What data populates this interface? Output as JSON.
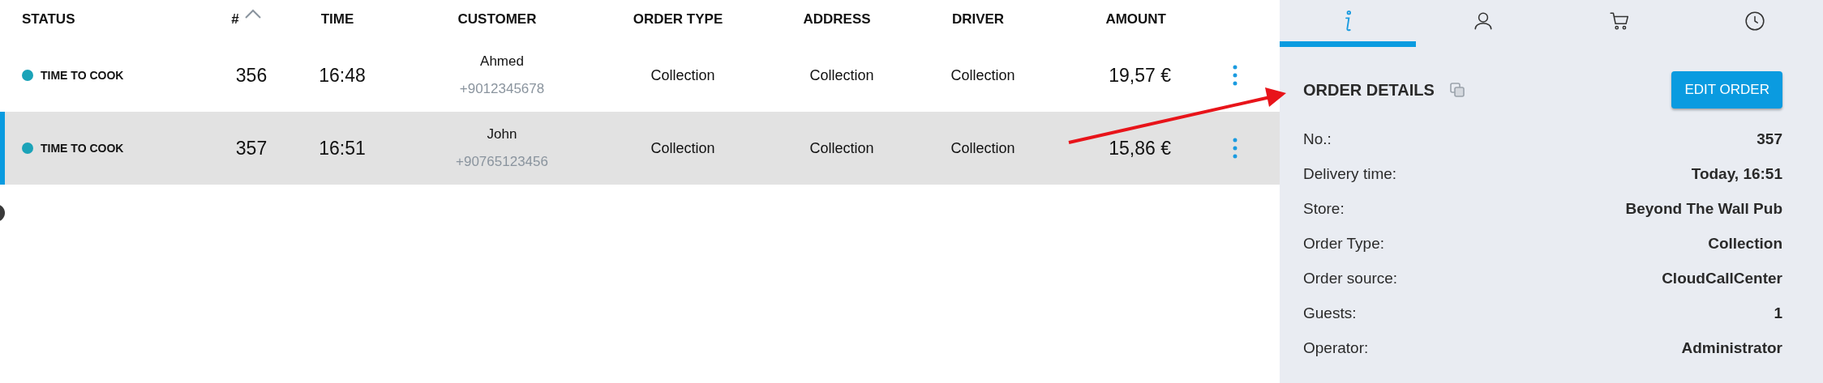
{
  "table": {
    "columns": [
      {
        "label": "STATUS",
        "sorted": false
      },
      {
        "label": "#",
        "sorted": true
      },
      {
        "label": "TIME",
        "sorted": false
      },
      {
        "label": "CUSTOMER",
        "sorted": false
      },
      {
        "label": "ORDER TYPE",
        "sorted": false
      },
      {
        "label": "ADDRESS",
        "sorted": false
      },
      {
        "label": "DRIVER",
        "sorted": false
      },
      {
        "label": "AMOUNT",
        "sorted": false
      }
    ],
    "rows": [
      {
        "status": "TIME TO COOK",
        "color": "#1ba3b8",
        "number": "356",
        "time": "16:48",
        "customer": "Ahmed",
        "phone": "+9012345678",
        "order_type": "Collection",
        "address": "Collection",
        "driver": "Collection",
        "amount": "19,57 €",
        "selected": false
      },
      {
        "status": "TIME TO COOK",
        "color": "#1ba3b8",
        "number": "357",
        "time": "16:51",
        "customer": "John",
        "phone": "+90765123456",
        "order_type": "Collection",
        "address": "Collection",
        "driver": "Collection",
        "amount": "15,86 €",
        "selected": true
      }
    ]
  },
  "panel": {
    "tabs": [
      {
        "kind": "info",
        "selected": true
      },
      {
        "kind": "person",
        "selected": false
      },
      {
        "kind": "cart",
        "selected": false
      },
      {
        "kind": "clock",
        "selected": false
      }
    ],
    "title": "ORDER DETAILS",
    "button": "EDIT ORDER",
    "details": [
      {
        "label": "No.:",
        "value": "357"
      },
      {
        "label": "Delivery time:",
        "value": "Today, 16:51"
      },
      {
        "label": "Store:",
        "value": "Beyond The Wall Pub"
      },
      {
        "label": "Order Type:",
        "value": "Collection"
      },
      {
        "label": "Order source:",
        "value": "CloudCallCenter"
      },
      {
        "label": "Guests:",
        "value": "1"
      },
      {
        "label": "Operator:",
        "value": "Administrator"
      }
    ]
  }
}
